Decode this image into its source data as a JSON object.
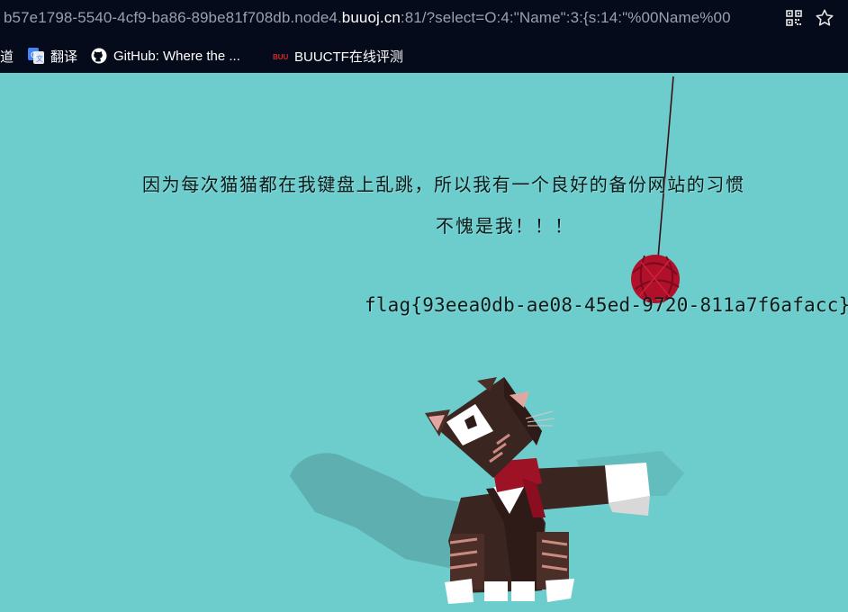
{
  "browser": {
    "url_prefix": "b57e1798-5540-4cf9-ba86-89be81f708db.node4.",
    "url_host": "buuoj.cn",
    "url_rest": ":81/?select=O:4:\"Name\":3:{s:14:\"%00Name%00",
    "icons": {
      "qr": "qr-code-icon",
      "star": "bookmark-star-icon"
    }
  },
  "bookmarks": [
    {
      "label": "道",
      "icon": ""
    },
    {
      "label": "翻译",
      "icon": "google-translate-icon"
    },
    {
      "label": "GitHub: Where the ...",
      "icon": "github-icon"
    },
    {
      "label": "BUUCTF在线评测",
      "icon": "buuctf-icon"
    }
  ],
  "page": {
    "line1": "因为每次猫猫都在我键盘上乱跳，所以我有一个良好的备份网站的习惯",
    "line2": "不愧是我！！！",
    "flag": "flag{93eea0db-ae08-45ed-9720-811a7f6afacc}",
    "background": "#6dcdcd",
    "yarn_color": "#b0102a",
    "cat_color": "#3b2520"
  }
}
